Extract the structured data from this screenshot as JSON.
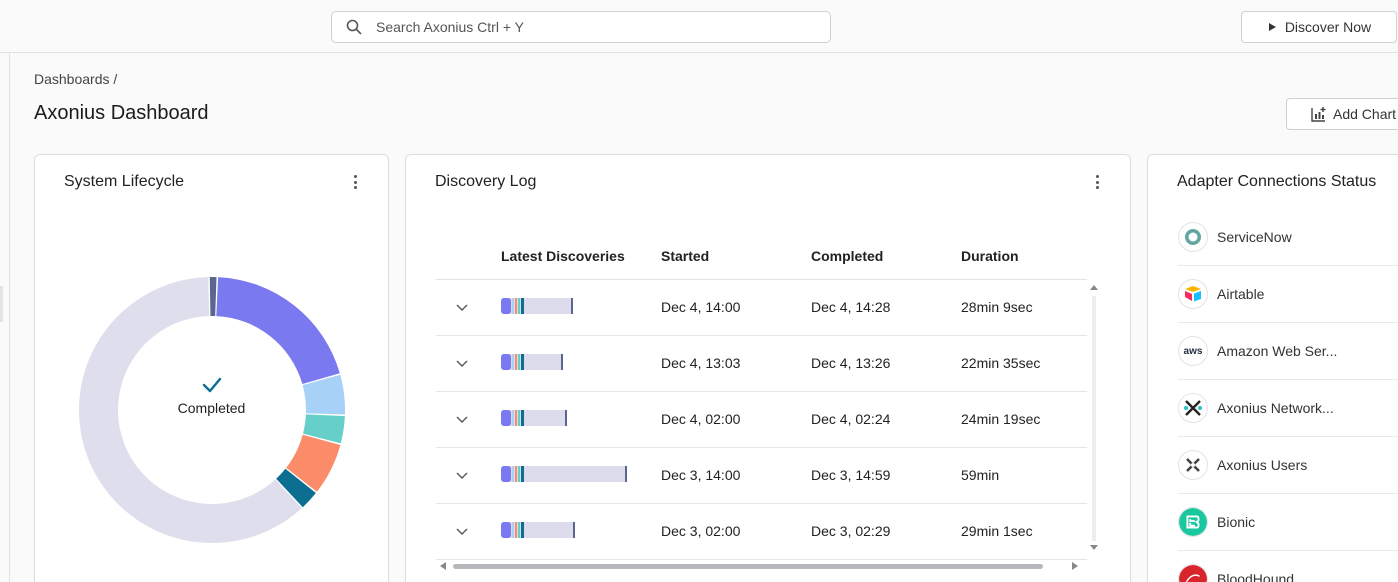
{
  "header": {
    "search_placeholder": "Search Axonius Ctrl + Y",
    "discover_label": "Discover Now"
  },
  "breadcrumb": "Dashboards /",
  "page_title": "Axonius Dashboard",
  "add_chart_label": "Add Chart",
  "lifecycle": {
    "title": "System Lifecycle",
    "status": "Completed",
    "segments": [
      {
        "fraction": 0.2,
        "color": "#7b79f0"
      },
      {
        "fraction": 0.05,
        "color": "#a8d1f7"
      },
      {
        "fraction": 0.035,
        "color": "#66cfc9"
      },
      {
        "fraction": 0.065,
        "color": "#fb8c6a"
      },
      {
        "fraction": 0.025,
        "color": "#0c6f92"
      },
      {
        "fraction": 0.615,
        "color": "#dedeec"
      },
      {
        "fraction": 0.01,
        "color": "#5a6690"
      }
    ]
  },
  "discovery_log": {
    "title": "Discovery Log",
    "columns": [
      "Latest Discoveries",
      "Started",
      "Completed",
      "Duration"
    ],
    "rows": [
      {
        "started": "Dec 4, 14:00",
        "completed": "Dec 4, 14:28",
        "duration": "28min 9sec",
        "progress": 0.47
      },
      {
        "started": "Dec 4, 13:03",
        "completed": "Dec 4, 13:26",
        "duration": "22min 35sec",
        "progress": 0.37
      },
      {
        "started": "Dec 4, 02:00",
        "completed": "Dec 4, 02:24",
        "duration": "24min 19sec",
        "progress": 0.41
      },
      {
        "started": "Dec 3, 14:00",
        "completed": "Dec 3, 14:59",
        "duration": "59min",
        "progress": 1.0
      },
      {
        "started": "Dec 3, 02:00",
        "completed": "Dec 3, 02:29",
        "duration": "29min 1sec",
        "progress": 0.49
      }
    ]
  },
  "adapters": {
    "title": "Adapter Connections Status",
    "items": [
      {
        "name": "ServiceNow",
        "icon": "servicenow-icon"
      },
      {
        "name": "Airtable",
        "icon": "airtable-icon"
      },
      {
        "name": "Amazon Web Ser...",
        "icon": "aws-icon",
        "logo_text": "aws"
      },
      {
        "name": "Axonius Network...",
        "icon": "axonius-network-icon"
      },
      {
        "name": "Axonius Users",
        "icon": "axonius-users-icon"
      },
      {
        "name": "Bionic",
        "icon": "bionic-icon"
      },
      {
        "name": "BloodHound",
        "icon": "bloodhound-icon"
      }
    ]
  }
}
